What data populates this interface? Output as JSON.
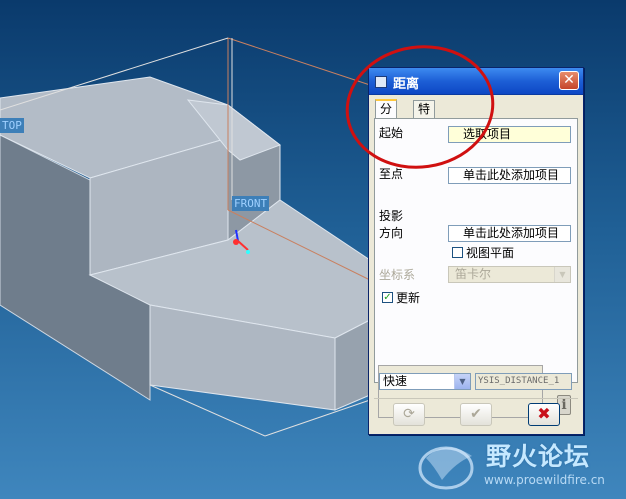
{
  "viewport": {
    "datum_labels": {
      "top": "TOP",
      "front": "FRONT"
    }
  },
  "dialog": {
    "title": "距离",
    "close_symbol": "✕",
    "tabs": [
      {
        "label": "分析",
        "active": true
      },
      {
        "label": "特征",
        "active": false
      }
    ],
    "start_label": "起始",
    "start_value": "选取项目",
    "to_label": "至点",
    "to_value": "单击此处添加项目",
    "projection_label": "投影",
    "direction_label": "方向",
    "direction_value": "单击此处添加项目",
    "view_plane_label": "视图平面",
    "view_plane_checked": false,
    "csys_label": "坐标系",
    "csys_value": "笛卡尔",
    "update_label": "更新",
    "update_checked": true,
    "mode_value": "快速",
    "name_value": "YSIS_DISTANCE_1",
    "info_symbol": "i",
    "buttons": {
      "repaint_symbol": "⟳",
      "ok_symbol": "✔",
      "cancel_symbol": "✖"
    }
  },
  "watermark": {
    "title": "野火论坛",
    "url": "www.proewildfire.cn"
  },
  "colors": {
    "dialog_bg": "#ece9d8",
    "titlebar": "#0d47c4",
    "highlight_field": "#ffffd9",
    "annotation_circle": "#d01010"
  }
}
